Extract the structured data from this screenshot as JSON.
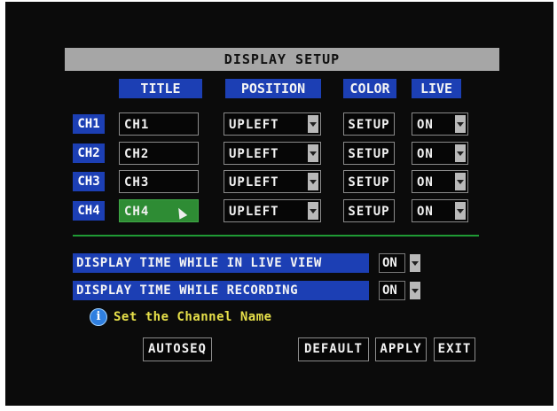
{
  "window": {
    "title": "DISPLAY SETUP"
  },
  "headers": {
    "title": "TITLE",
    "position": "POSITION",
    "color": "COLOR",
    "live": "LIVE"
  },
  "channels": [
    {
      "label": "CH1",
      "title": "CH1",
      "position": "UPLEFT",
      "color": "SETUP",
      "live": "ON"
    },
    {
      "label": "CH2",
      "title": "CH2",
      "position": "UPLEFT",
      "color": "SETUP",
      "live": "ON"
    },
    {
      "label": "CH3",
      "title": "CH3",
      "position": "UPLEFT",
      "color": "SETUP",
      "live": "ON"
    },
    {
      "label": "CH4",
      "title": "CH4",
      "position": "UPLEFT",
      "color": "SETUP",
      "live": "ON"
    }
  ],
  "options": [
    {
      "label": "DISPLAY TIME WHILE IN LIVE VIEW",
      "value": "ON"
    },
    {
      "label": "DISPLAY TIME WHILE RECORDING",
      "value": "ON"
    }
  ],
  "hint": "Set the Channel Name",
  "buttons": {
    "autoseq": "AUTOSEQ",
    "default": "DEFAULT",
    "apply": "APPLY",
    "exit": "EXIT"
  },
  "icons": {
    "info": "info-icon",
    "dropdown": "chevron-down-icon",
    "cursor": "mouse-pointer-icon"
  },
  "colors": {
    "header_blue": "#1c3fb4",
    "active_field": "#2e8c34",
    "separator": "#1f9a34",
    "hint_yellow": "#e7e04a",
    "title_gray": "#a6a6a6"
  }
}
